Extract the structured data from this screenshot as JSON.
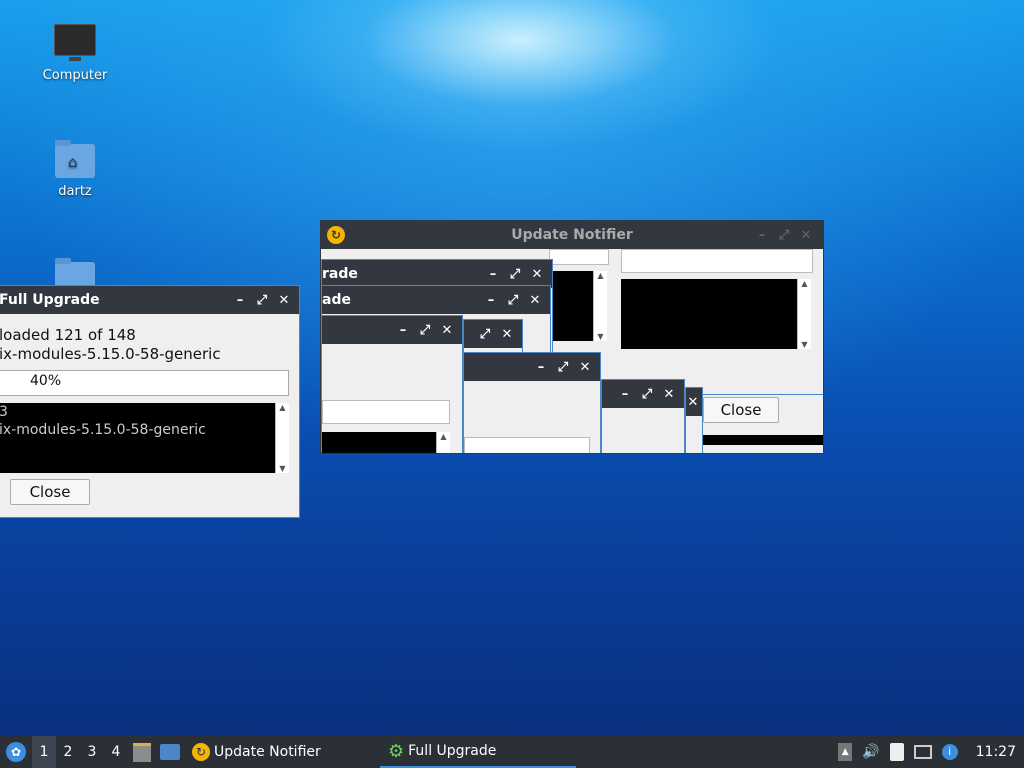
{
  "desktop": {
    "icons": [
      {
        "label": "Computer"
      },
      {
        "label": "dartz"
      }
    ]
  },
  "full_upgrade_window": {
    "title": "Full Upgrade",
    "status_line1": "loaded 121 of 148",
    "status_line2": "ix-modules-5.15.0-58-generic",
    "progress_text": "40%",
    "progress_value": 40,
    "log_line1": "3",
    "log_line2": "ix-modules-5.15.0-58-generic",
    "close_label": "Close"
  },
  "update_notifier": {
    "title": "Update Notifier",
    "stack_title1": "rade",
    "stack_title2": "ade",
    "close_label": "Close"
  },
  "taskbar": {
    "workspaces": [
      "1",
      "2",
      "3",
      "4"
    ],
    "tasks": [
      {
        "label": "Update Notifier"
      },
      {
        "label": "Full Upgrade"
      }
    ],
    "clock": "11:27"
  }
}
